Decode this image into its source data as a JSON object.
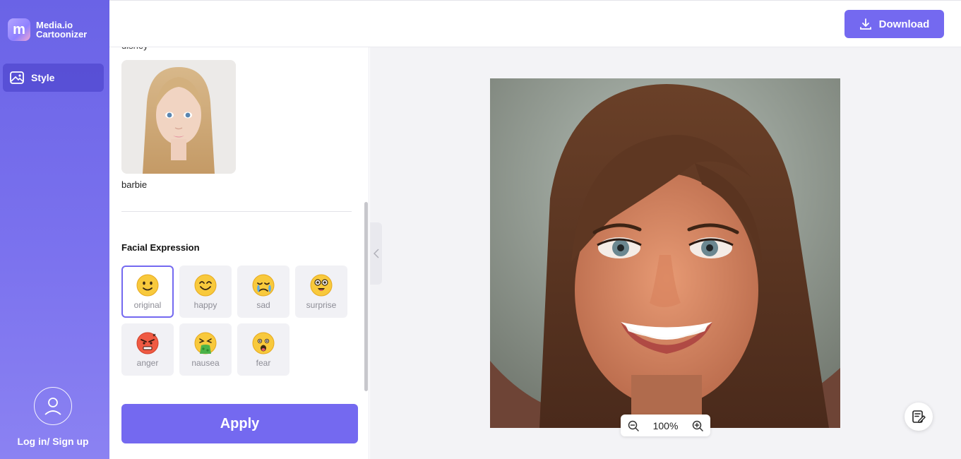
{
  "app": {
    "logo_letter": "m",
    "name_line1": "Media.io",
    "name_line2": "Cartoonizer"
  },
  "sidebar": {
    "items": [
      {
        "label": "Style",
        "icon": "image-icon",
        "active": true
      }
    ],
    "login_label": "Log in/ Sign up"
  },
  "topbar": {
    "download_label": "Download"
  },
  "panel": {
    "cut_label": "disney",
    "style_label": "barbie",
    "facial_expression_title": "Facial Expression",
    "expressions": [
      {
        "label": "original",
        "active": true
      },
      {
        "label": "happy"
      },
      {
        "label": "sad"
      },
      {
        "label": "surprise"
      },
      {
        "label": "anger"
      },
      {
        "label": "nausea"
      },
      {
        "label": "fear"
      }
    ],
    "apply_label": "Apply"
  },
  "preview": {
    "zoom": "100%"
  },
  "colors": {
    "accent": "#7469f0",
    "sidebar_top": "#6a63e6",
    "preview_bg": "#f3f3f6"
  }
}
